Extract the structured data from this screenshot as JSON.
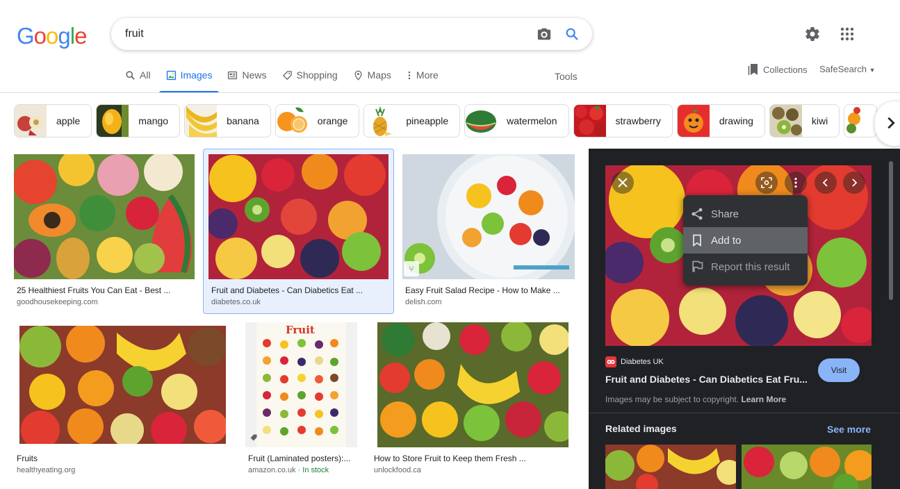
{
  "search": {
    "query": "fruit"
  },
  "nav": {
    "tabs": [
      {
        "label": "All"
      },
      {
        "label": "Images"
      },
      {
        "label": "News"
      },
      {
        "label": "Shopping"
      },
      {
        "label": "Maps"
      },
      {
        "label": "More"
      }
    ],
    "tools": "Tools",
    "collections": "Collections",
    "safesearch": "SafeSearch"
  },
  "chips": [
    "apple",
    "mango",
    "banana",
    "orange",
    "pineapple",
    "watermelon",
    "strawberry",
    "drawing",
    "kiwi"
  ],
  "results": [
    {
      "title": "25 Healthiest Fruits You Can Eat - Best ...",
      "source": "goodhousekeeping.com"
    },
    {
      "title": "Fruit and Diabetes - Can Diabetics Eat ...",
      "source": "diabetes.co.uk"
    },
    {
      "title": "Easy Fruit Salad Recipe - How to Make ...",
      "source": "delish.com"
    },
    {
      "title": "Fruits",
      "source": "healthyeating.org"
    },
    {
      "title": "Fruit (Laminated posters):...",
      "source": "amazon.co.uk",
      "stock": "In stock"
    },
    {
      "title": "How to Store Fruit to Keep them Fresh ...",
      "source": "unlockfood.ca"
    }
  ],
  "poster_heading": "Fruit",
  "panel": {
    "menu": {
      "share": "Share",
      "add_to": "Add to",
      "report": "Report this result"
    },
    "source": "Diabetes UK",
    "title": "Fruit and Diabetes - Can Diabetics Eat Fru...",
    "visit": "Visit",
    "copyright": "Images may be subject to copyright.",
    "learn_more": "Learn More",
    "related": "Related images",
    "see_more": "See more"
  }
}
